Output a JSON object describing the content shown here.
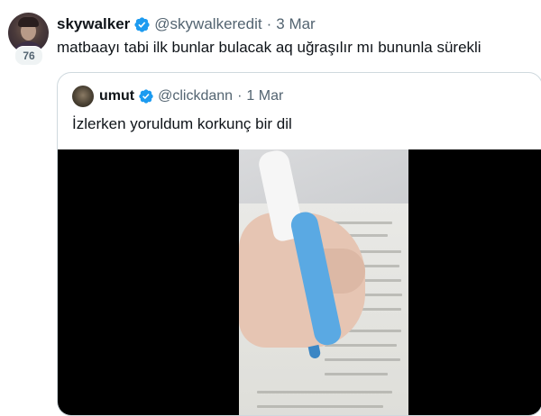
{
  "tweet": {
    "author_name": "skywalker",
    "handle": "@skywalkeredit",
    "separator": "·",
    "date": "3 Mar",
    "badge_count": "76",
    "text": "matbaayı tabi ilk bunlar bulacak aq uğraşılır mı bununla sürekli",
    "verified_icon": "verified-badge-icon"
  },
  "quoted_tweet": {
    "author_name": "umut",
    "handle": "@clickdann",
    "separator": "·",
    "date": "1 Mar",
    "text": "İzlerken yoruldum korkunç bir dil",
    "verified_icon": "verified-badge-icon",
    "media_type": "video"
  },
  "colors": {
    "verified_blue": "#1d9bf0",
    "secondary_text": "#536471",
    "border": "#cfd9de"
  }
}
